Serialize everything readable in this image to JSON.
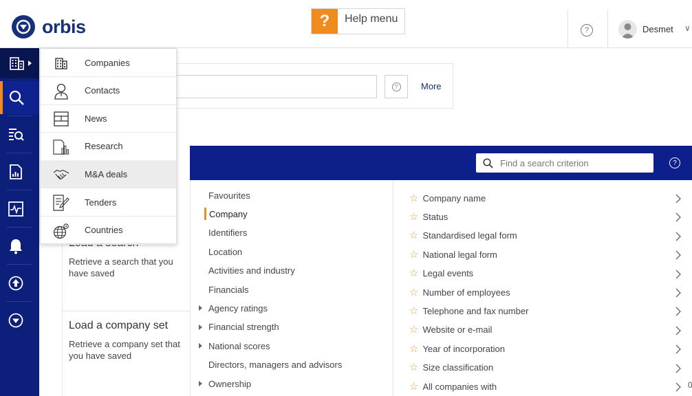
{
  "header": {
    "logo_text": "orbis",
    "help_symbol": "?",
    "help_label": "Help menu",
    "help_icon_symbol": "?",
    "user_name": "Desmet",
    "user_chevron": "∨"
  },
  "sidebar": {
    "items": [
      {
        "icon": "building-icon",
        "active": false
      },
      {
        "icon": "search-icon",
        "active": true
      },
      {
        "icon": "search-list-icon",
        "active": false
      },
      {
        "icon": "report-icon",
        "active": false
      },
      {
        "icon": "monitor-icon",
        "active": false
      },
      {
        "icon": "bell-icon",
        "active": false
      },
      {
        "icon": "upload-icon",
        "active": false
      },
      {
        "icon": "orbis-logo-icon",
        "active": false
      }
    ]
  },
  "dropdown": {
    "items": [
      {
        "label": "Companies",
        "icon": "building-icon"
      },
      {
        "label": "Contacts",
        "icon": "contact-icon"
      },
      {
        "label": "News",
        "icon": "news-icon"
      },
      {
        "label": "Research",
        "icon": "research-icon"
      },
      {
        "label": "M&A deals",
        "icon": "handshake-icon",
        "hover": true
      },
      {
        "label": "Tenders",
        "icon": "tender-icon"
      },
      {
        "label": "Countries",
        "icon": "globe-icon"
      }
    ]
  },
  "search": {
    "placeholder": "",
    "help_symbol": "?",
    "more_label": "More"
  },
  "band": {
    "find_placeholder": "Find a search criterion",
    "help_symbol": "?"
  },
  "cards": {
    "load_search_title": "Load a search",
    "load_search_desc": "Retrieve a search that you have saved",
    "load_set_title": "Load a company set",
    "load_set_desc": "Retrieve a company set that you have saved"
  },
  "categories": [
    {
      "label": "Favourites",
      "arrow": false,
      "active": false
    },
    {
      "label": "Company",
      "arrow": false,
      "active": true
    },
    {
      "label": "Identifiers",
      "arrow": false,
      "active": false
    },
    {
      "label": "Location",
      "arrow": false,
      "active": false
    },
    {
      "label": "Activities and industry",
      "arrow": false,
      "active": false
    },
    {
      "label": "Financials",
      "arrow": false,
      "active": false
    },
    {
      "label": "Agency ratings",
      "arrow": true,
      "active": false
    },
    {
      "label": "Financial strength",
      "arrow": true,
      "active": false
    },
    {
      "label": "National scores",
      "arrow": true,
      "active": false
    },
    {
      "label": "Directors, managers and advisors",
      "arrow": false,
      "active": false
    },
    {
      "label": "Ownership",
      "arrow": true,
      "active": false
    }
  ],
  "criteria": [
    {
      "label": "Company name"
    },
    {
      "label": "Status"
    },
    {
      "label": "Standardised legal form"
    },
    {
      "label": "National legal form"
    },
    {
      "label": "Legal events"
    },
    {
      "label": "Number of employees"
    },
    {
      "label": "Telephone and fax number"
    },
    {
      "label": "Website or e-mail"
    },
    {
      "label": "Year of incorporation"
    },
    {
      "label": "Size classification"
    },
    {
      "label": "All companies with"
    }
  ],
  "star_symbol": "☆",
  "edge_digit": "0",
  "colors": {
    "brand_navy": "#17307a",
    "band_blue": "#0c1f8a",
    "accent_orange": "#f28b1e",
    "star_gold": "#e9a13f"
  }
}
